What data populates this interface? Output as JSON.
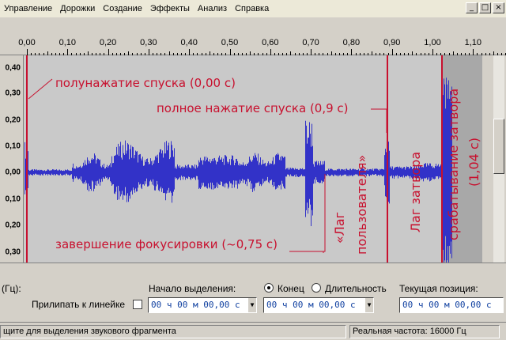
{
  "menu": {
    "items": [
      "Управление",
      "Дорожки",
      "Создание",
      "Эффекты",
      "Анализ",
      "Справка"
    ]
  },
  "window_buttons": [
    "_",
    "□",
    "×"
  ],
  "ruler": {
    "ticks": [
      "0,00",
      "0,10",
      "0,20",
      "0,30",
      "0,40",
      "0,50",
      "0,60",
      "0,70",
      "0,80",
      "0,90",
      "1,00",
      "1,10"
    ]
  },
  "vruler": {
    "labels": [
      "0,40",
      "0,30",
      "0,20",
      "0,10",
      "0,00",
      "0,10",
      "0,20",
      "0,30"
    ]
  },
  "annotations": {
    "half_press": "полунажатие спуска (0,00 с)",
    "full_press": "полное нажатие спуска (0,9 с)",
    "focus_done": "завершение фокусировки (~0,75 с)",
    "user_lag_1": "«Лаг",
    "user_lag_2": "пользователя»",
    "shutter_lag": "Лаг затвора",
    "shutter_fire_1": "срабатывание затвора",
    "shutter_fire_2": "(1,04 с)"
  },
  "bottom": {
    "rate_label": "(Гц):",
    "snap_label": "Прилипать к линейке",
    "selection_start_label": "Начало выделения:",
    "end_label": "Конец",
    "length_label": "Длительность",
    "current_pos_label": "Текущая позиция:",
    "time1": "00 ч 00 м 00,00 с",
    "time2": "00 ч 00 м 00,00 с",
    "time3": "00 ч 00 м 00,00 с",
    "end_selected": true,
    "snap_checked": false
  },
  "status": {
    "left": "щите для выделения звукового фрагмента",
    "right": "Реальная частота: 16000 Гц"
  },
  "colors": {
    "waveform": "#3232c8",
    "annotation": "#c8102e",
    "marker": "#c8102e"
  }
}
